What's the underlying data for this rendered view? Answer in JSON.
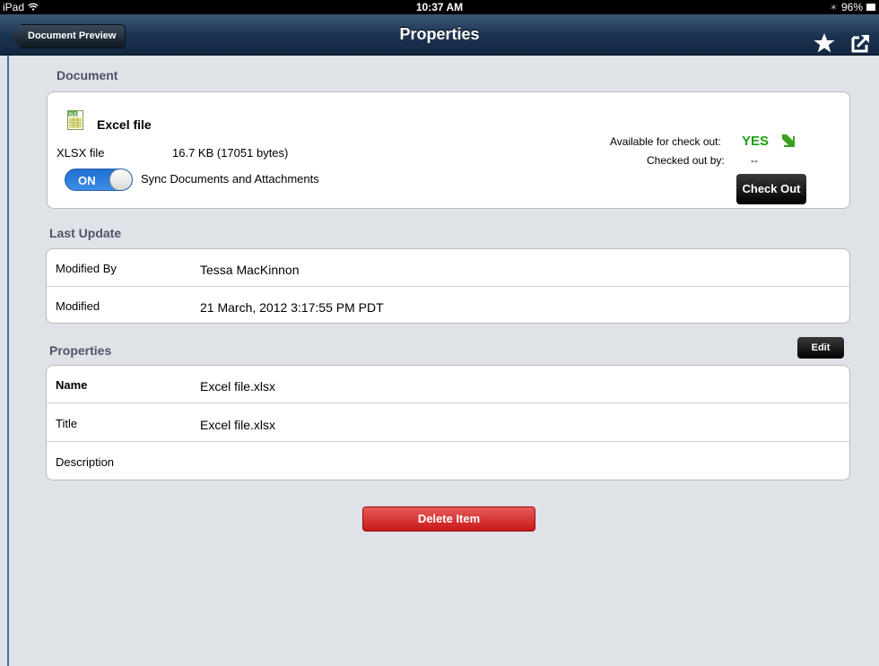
{
  "status_bar": {
    "device": "iPad",
    "time": "10:37 AM",
    "battery": "96%"
  },
  "nav": {
    "back_label": "Document Preview",
    "title": "Properties"
  },
  "document": {
    "heading": "Document",
    "name": "Excel file",
    "type": "XLSX file",
    "size": "16.7 KB (17051 bytes)",
    "sync_toggle": "ON",
    "sync_label": "Sync Documents and Attachments",
    "available_label": "Available for check out:",
    "available_value": "YES",
    "checked_out_label": "Checked out by:",
    "checked_out_value": "--",
    "checkout_button": "Check Out"
  },
  "last_update": {
    "heading": "Last Update",
    "rows": [
      {
        "label": "Modified By",
        "value": "Tessa MacKinnon"
      },
      {
        "label": "Modified",
        "value": "21 March, 2012 3:17:55 PM PDT"
      }
    ]
  },
  "properties": {
    "heading": "Properties",
    "edit_button": "Edit",
    "rows": [
      {
        "label": "Name",
        "value": "Excel file.xlsx"
      },
      {
        "label": "Title",
        "value": "Excel file.xlsx"
      },
      {
        "label": "Description",
        "value": ""
      }
    ]
  },
  "delete_button": "Delete Item",
  "colors": {
    "nav_bar": "#1d3553",
    "yes_green": "#1aa014",
    "delete_red": "#d42a2a",
    "toggle_blue": "#2a7ddc"
  }
}
